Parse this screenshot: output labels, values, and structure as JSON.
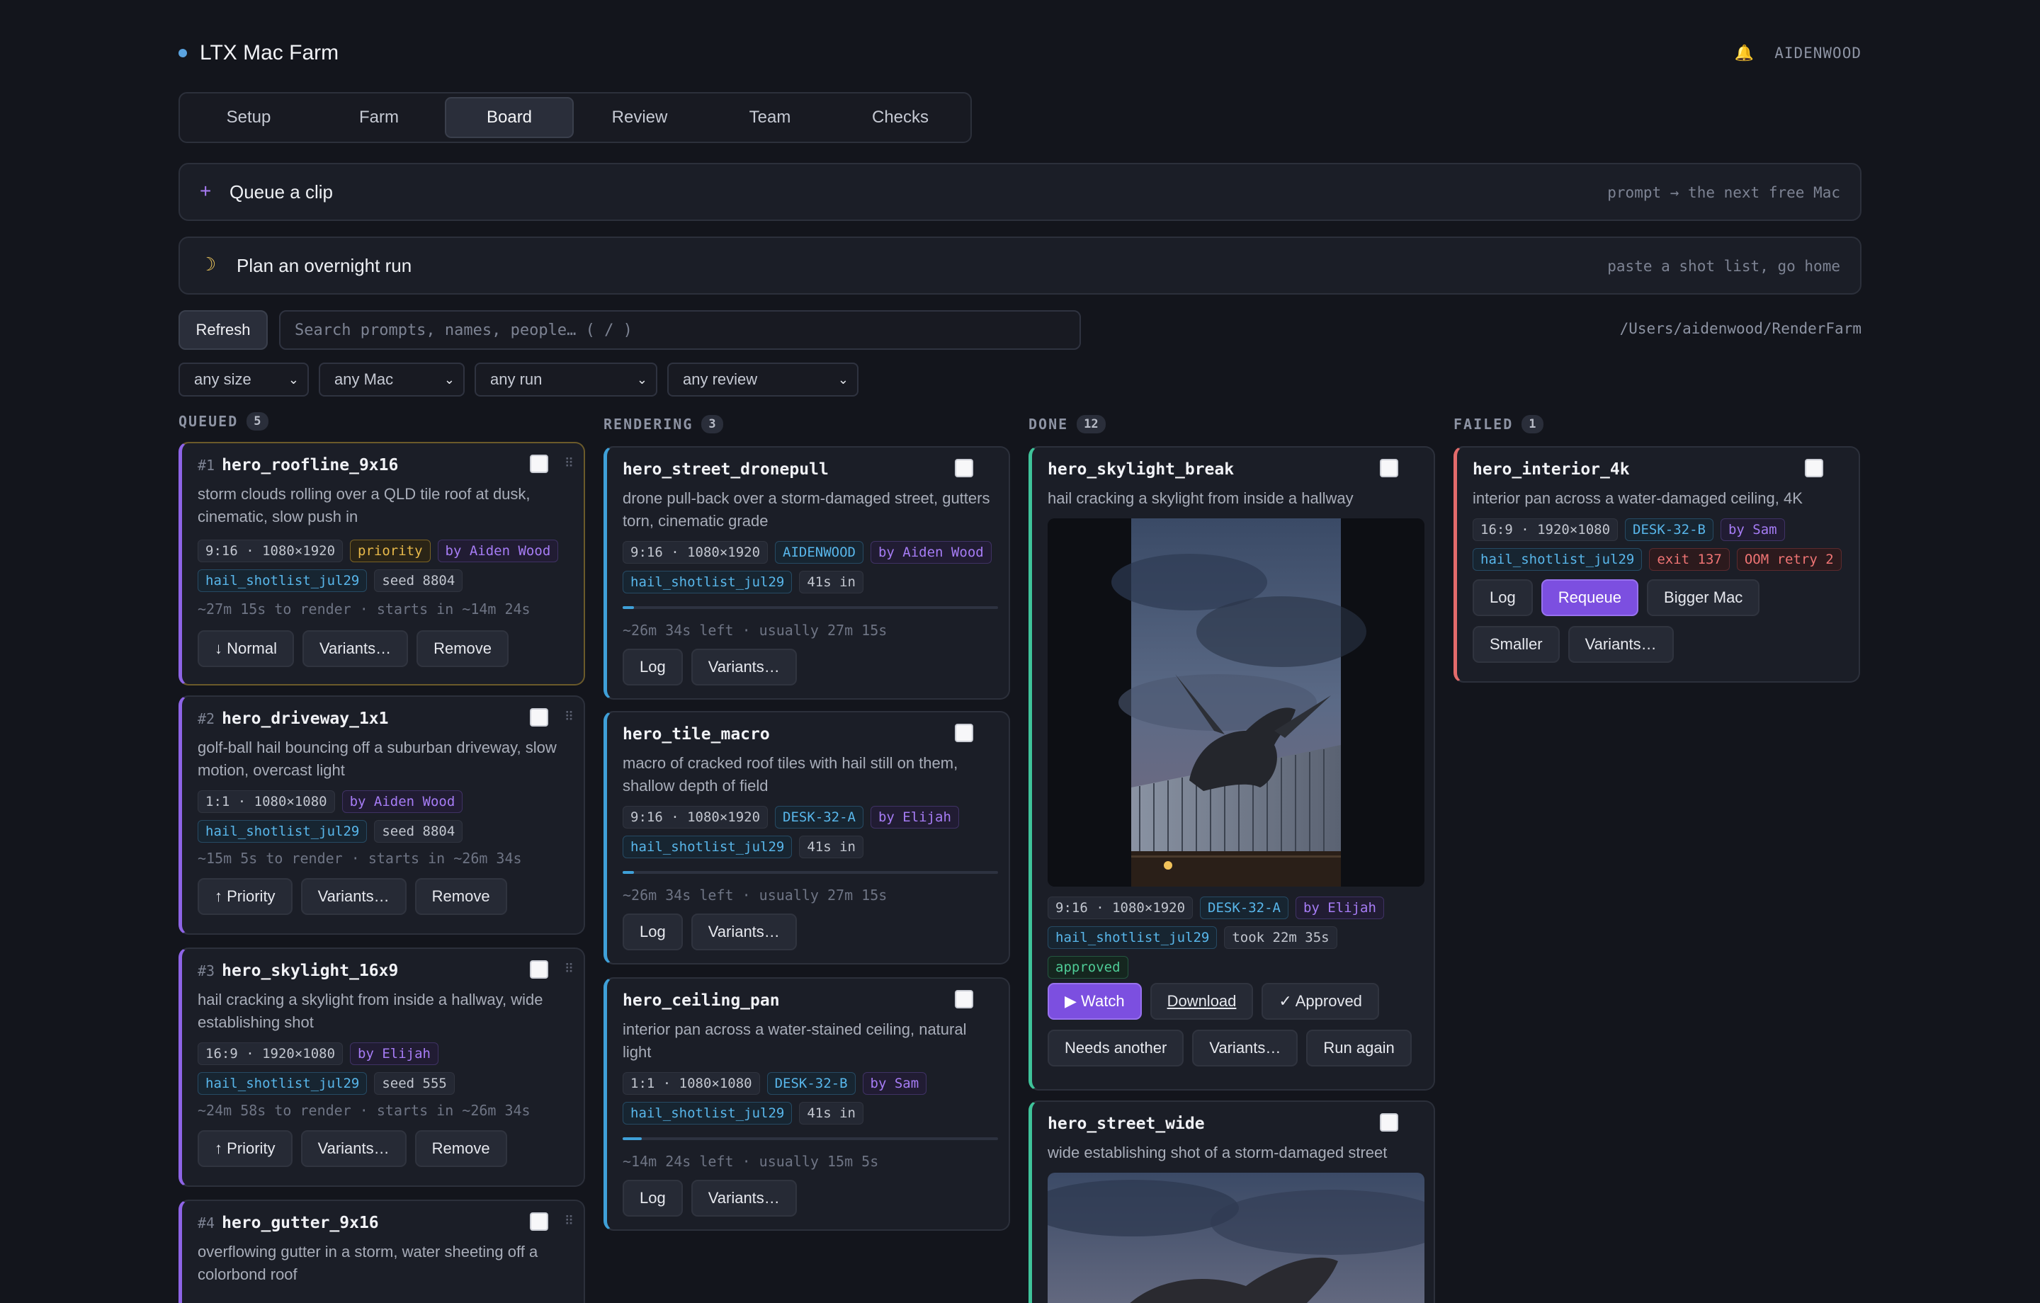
{
  "app": {
    "title": "LTX Mac Farm",
    "user": "AIDENWOOD"
  },
  "tabs": [
    "Setup",
    "Farm",
    "Board",
    "Review",
    "Team",
    "Checks"
  ],
  "queue_bar": {
    "title": "Queue a clip",
    "hint": "prompt → the next free Mac"
  },
  "overnight_bar": {
    "title": "Plan an overnight run",
    "hint": "paste a shot list, go home"
  },
  "toolbar": {
    "refresh": "Refresh",
    "search_placeholder": "Search prompts, names, people…  ( / )",
    "path": "/Users/aidenwood/RenderFarm"
  },
  "filters": [
    "any size",
    "any Mac",
    "any run",
    "any review"
  ],
  "columns": {
    "queued": {
      "label": "QUEUED",
      "count": "5",
      "cards": [
        {
          "num": "#1",
          "name": "hero_roofline_9x16",
          "desc": "storm clouds rolling over a QLD tile roof at dusk, cinematic, slow push in",
          "tags": [
            "9:16 · 1080×1920",
            "priority",
            "by Aiden Wood",
            "hail_shotlist_jul29",
            "seed 8804"
          ],
          "meta": "~27m 15s to render · starts in ~14m 24s",
          "btns": [
            "↓ Normal",
            "Variants…",
            "Remove"
          ]
        },
        {
          "num": "#2",
          "name": "hero_driveway_1x1",
          "desc": "golf-ball hail bouncing off a suburban driveway, slow motion, overcast light",
          "tags": [
            "1:1 · 1080×1080",
            "by Aiden Wood",
            "hail_shotlist_jul29",
            "seed 8804"
          ],
          "meta": "~15m 5s to render · starts in ~26m 34s",
          "btns": [
            "↑ Priority",
            "Variants…",
            "Remove"
          ]
        },
        {
          "num": "#3",
          "name": "hero_skylight_16x9",
          "desc": "hail cracking a skylight from inside a hallway, wide establishing shot",
          "tags": [
            "16:9 · 1920×1080",
            "by Elijah",
            "hail_shotlist_jul29",
            "seed 555"
          ],
          "meta": "~24m 58s to render · starts in ~26m 34s",
          "btns": [
            "↑ Priority",
            "Variants…",
            "Remove"
          ]
        },
        {
          "num": "#4",
          "name": "hero_gutter_9x16",
          "desc": "overflowing gutter in a storm, water sheeting off a colorbond roof"
        }
      ]
    },
    "rendering": {
      "label": "RENDERING",
      "count": "3",
      "cards": [
        {
          "name": "hero_street_dronepull",
          "desc": "drone pull-back over a storm-damaged street, gutters torn, cinematic grade",
          "tags": [
            "9:16 · 1080×1920",
            "AIDENWOOD",
            "by Aiden Wood",
            "hail_shotlist_jul29",
            "41s in"
          ],
          "progress": 0.03,
          "meta": "~26m 34s left · usually 27m 15s",
          "btns": [
            "Log",
            "Variants…"
          ]
        },
        {
          "name": "hero_tile_macro",
          "desc": "macro of cracked roof tiles with hail still on them, shallow depth of field",
          "tags": [
            "9:16 · 1080×1920",
            "DESK-32-A",
            "by Elijah",
            "hail_shotlist_jul29",
            "41s in"
          ],
          "progress": 0.03,
          "meta": "~26m 34s left · usually 27m 15s",
          "btns": [
            "Log",
            "Variants…"
          ]
        },
        {
          "name": "hero_ceiling_pan",
          "desc": "interior pan across a water-stained ceiling, natural light",
          "tags": [
            "1:1 · 1080×1080",
            "DESK-32-B",
            "by Sam",
            "hail_shotlist_jul29",
            "41s in"
          ],
          "progress": 0.05,
          "meta": "~14m 24s left · usually 15m 5s",
          "btns": [
            "Log",
            "Variants…"
          ]
        }
      ]
    },
    "done": {
      "label": "DONE",
      "count": "12",
      "cards": [
        {
          "name": "hero_skylight_break",
          "desc": "hail cracking a skylight from inside a hallway",
          "tags": [
            "9:16 · 1080×1920",
            "DESK-32-A",
            "by Elijah",
            "hail_shotlist_jul29",
            "took 22m 35s",
            "approved"
          ],
          "btns": [
            "▶ Watch",
            "Download",
            "✓ Approved",
            "Needs another",
            "Variants…",
            "Run again"
          ]
        },
        {
          "name": "hero_street_wide",
          "desc": "wide establishing shot of a storm-damaged street"
        }
      ]
    },
    "failed": {
      "label": "FAILED",
      "count": "1",
      "cards": [
        {
          "name": "hero_interior_4k",
          "desc": "interior pan across a water-damaged ceiling, 4K",
          "tags": [
            "16:9 · 1920×1080",
            "DESK-32-B",
            "by Sam",
            "hail_shotlist_jul29",
            "exit 137",
            "OOM retry 2"
          ],
          "btns": [
            "Log",
            "Requeue",
            "Bigger Mac",
            "Smaller",
            "Variants…"
          ]
        }
      ]
    }
  },
  "colors": {
    "accent": "#7c4fe0",
    "queued": "#8e64e6",
    "rendering": "#3fa0d8",
    "done": "#3fc39a",
    "failed": "#e36b6b"
  }
}
